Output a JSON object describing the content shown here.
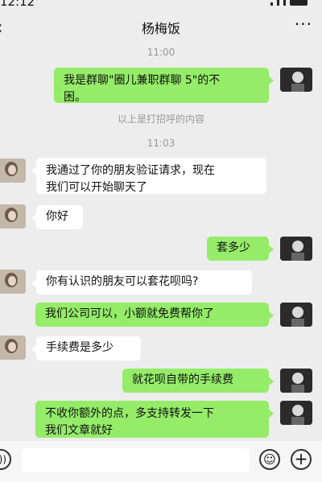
{
  "status": {
    "time": "12:12"
  },
  "header": {
    "title": "杨梅饭",
    "back_icon": "chevron-left-icon",
    "more_icon": "more-dots-icon"
  },
  "chat": {
    "time1": "11:00",
    "system_note": "以上是打招呼的内容",
    "time2": "11:03",
    "messages": [
      {
        "from": "me",
        "text": "我是群聊\"圈儿兼职群聊 5\"的不\n困。"
      },
      {
        "from": "friend",
        "text": "我通过了你的朋友验证请求，现在\n我们可以开始聊天了"
      },
      {
        "from": "friend",
        "text": "你好"
      },
      {
        "from": "me",
        "text": "套多少"
      },
      {
        "from": "friend",
        "text": "你有认识的朋友可以套花呗吗?"
      },
      {
        "from": "me",
        "text": "我们公司可以，小额就免费帮你了"
      },
      {
        "from": "friend",
        "text": "手续费是多少"
      },
      {
        "from": "me",
        "text": "就花呗自带的手续费"
      },
      {
        "from": "me",
        "text": "不收你额外的点，多支持转发一下\n我们文章就好"
      }
    ]
  },
  "input_bar": {
    "voice_icon": "voice-icon",
    "emoji_icon": "emoji-icon",
    "plus_icon": "plus-icon"
  },
  "colors": {
    "my_bubble": "#95ec69",
    "friend_bubble": "#ffffff",
    "background": "#ededed"
  }
}
